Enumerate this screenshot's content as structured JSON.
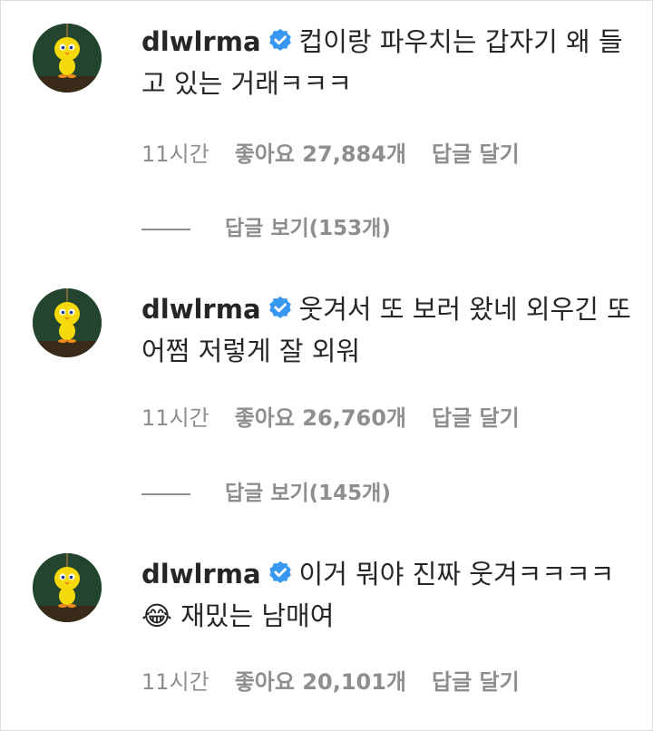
{
  "comments": [
    {
      "username": "dlwlrma",
      "text": "컵이랑 파우치는 갑자기 왜 들고 있는 거래ㅋㅋㅋ",
      "time": "11시간",
      "likes": "좋아요 27,884개",
      "reply_label": "답글 달기",
      "view_replies": "답글 보기(153개)"
    },
    {
      "username": "dlwlrma",
      "text": "웃겨서 또 보러 왔네 외우긴 또 어쩜 저렇게 잘 외워",
      "time": "11시간",
      "likes": "좋아요 26,760개",
      "reply_label": "답글 달기",
      "view_replies": "답글 보기(145개)"
    },
    {
      "username": "dlwlrma",
      "text": "이거 뭐야 진짜 웃겨ㅋㅋㅋㅋ😂 재밌는 남매여",
      "time": "11시간",
      "likes": "좋아요 20,101개",
      "reply_label": "답글 달기"
    }
  ],
  "icons": {
    "avatar": "tweety-avatar-icon",
    "verified": "verified-badge-icon",
    "verified_color": "#3897f0"
  }
}
